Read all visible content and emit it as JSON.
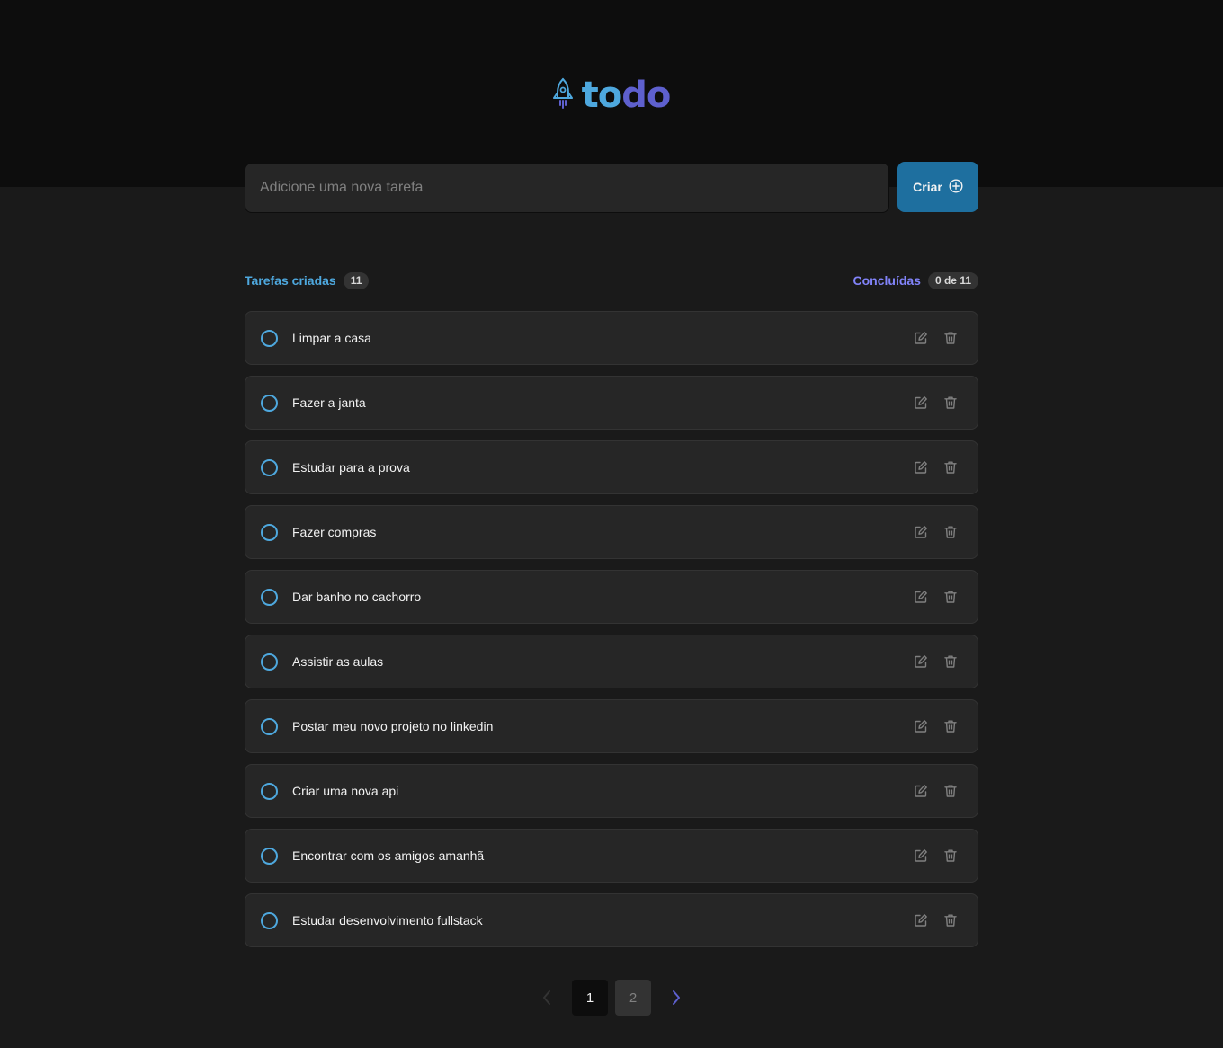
{
  "app": {
    "logo_part1": "to",
    "logo_part2": "do",
    "colors": {
      "blue": "#4ea8de",
      "purple": "#5e60ce",
      "blue_dark": "#1e6f9f",
      "purple_light": "#8284fa"
    }
  },
  "form": {
    "placeholder": "Adicione uma nova tarefa",
    "value": "",
    "create_label": "Criar"
  },
  "counters": {
    "created_label": "Tarefas criadas",
    "created_count": "11",
    "done_label": "Concluídas",
    "done_count": "0 de 11"
  },
  "tasks": [
    {
      "text": "Limpar a casa",
      "done": false
    },
    {
      "text": "Fazer a janta",
      "done": false
    },
    {
      "text": "Estudar para a prova",
      "done": false
    },
    {
      "text": "Fazer compras",
      "done": false
    },
    {
      "text": "Dar banho no cachorro",
      "done": false
    },
    {
      "text": "Assistir as aulas",
      "done": false
    },
    {
      "text": "Postar meu novo projeto no linkedin",
      "done": false
    },
    {
      "text": "Criar uma nova api",
      "done": false
    },
    {
      "text": "Encontrar com os amigos amanhã",
      "done": false
    },
    {
      "text": "Estudar desenvolvimento fullstack",
      "done": false
    }
  ],
  "pagination": {
    "pages": [
      "1",
      "2"
    ],
    "current": "1",
    "prev_icon": "chevron-left-icon",
    "next_icon": "chevron-right-icon"
  }
}
